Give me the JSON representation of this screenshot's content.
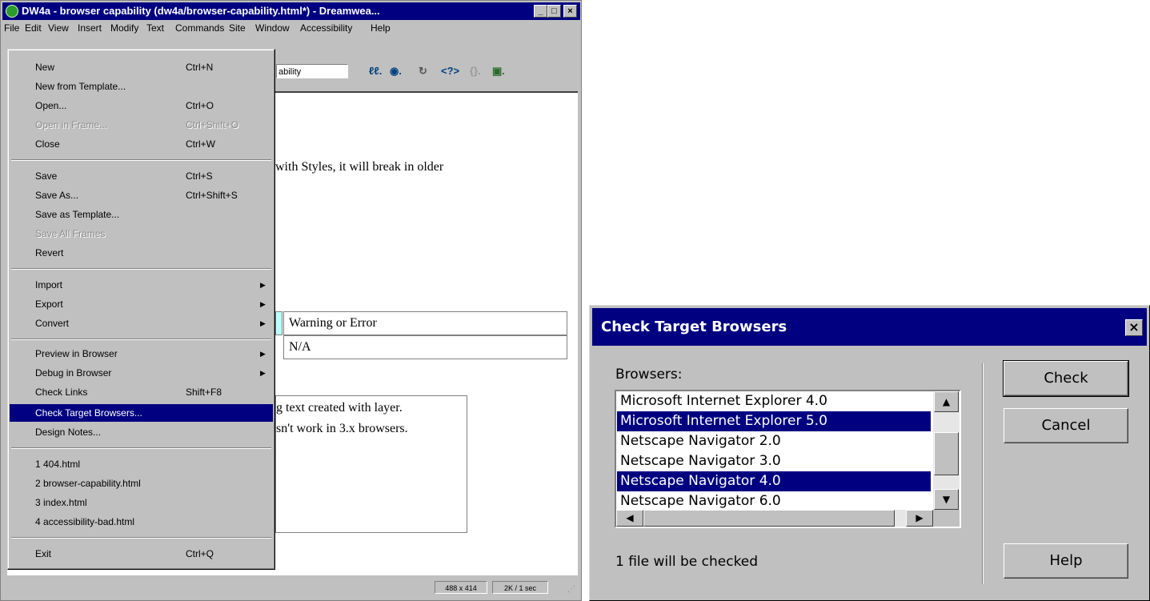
{
  "window": {
    "title": "DW4a - browser capability (dw4a/browser-capability.html*) - Dreamwea...",
    "controls": {
      "minimize": "_",
      "maximize": "□",
      "close": "×"
    }
  },
  "menubar": [
    "File",
    "Edit",
    "View",
    "Insert",
    "Modify",
    "Text",
    "Commands",
    "Site",
    "Window",
    "Accessibility",
    "Help"
  ],
  "toolbar": {
    "title_field": "ability"
  },
  "document": {
    "line1": "with Styles, it will break in older",
    "table": [
      [
        "Warning or Error"
      ],
      [
        "N/A"
      ]
    ],
    "layer_text_1": "g text created with layer.",
    "layer_text_2": "sn't work in 3.x browsers."
  },
  "statusbar": {
    "size": "488 x 414",
    "download": "2K / 1 sec"
  },
  "file_menu": {
    "items": [
      {
        "label": "New",
        "shortcut": "Ctrl+N"
      },
      {
        "label": "New from Template...",
        "shortcut": ""
      },
      {
        "label": "Open...",
        "shortcut": "Ctrl+O"
      },
      {
        "label": "Open in Frame...",
        "shortcut": "Ctrl+Shift+O",
        "disabled": true
      },
      {
        "label": "Close",
        "shortcut": "Ctrl+W"
      },
      {
        "label": "Save",
        "shortcut": "Ctrl+S"
      },
      {
        "label": "Save As...",
        "shortcut": "Ctrl+Shift+S"
      },
      {
        "label": "Save as Template...",
        "shortcut": ""
      },
      {
        "label": "Save All Frames",
        "shortcut": "",
        "disabled": true
      },
      {
        "label": "Revert",
        "shortcut": ""
      },
      {
        "label": "Import",
        "shortcut": "",
        "submenu": true
      },
      {
        "label": "Export",
        "shortcut": "",
        "submenu": true
      },
      {
        "label": "Convert",
        "shortcut": "",
        "submenu": true
      },
      {
        "label": "Preview in Browser",
        "shortcut": "",
        "submenu": true
      },
      {
        "label": "Debug in Browser",
        "shortcut": "",
        "submenu": true
      },
      {
        "label": "Check Links",
        "shortcut": "Shift+F8"
      },
      {
        "label": "Check Target Browsers...",
        "shortcut": "",
        "selected": true
      },
      {
        "label": "Design Notes...",
        "shortcut": ""
      },
      {
        "label": "1 404.html",
        "shortcut": ""
      },
      {
        "label": "2 browser-capability.html",
        "shortcut": ""
      },
      {
        "label": "3 index.html",
        "shortcut": ""
      },
      {
        "label": "4 accessibility-bad.html",
        "shortcut": ""
      },
      {
        "label": "Exit",
        "shortcut": "Ctrl+Q"
      }
    ]
  },
  "dialog": {
    "title": "Check Target Browsers",
    "close": "×",
    "browsers_label": "Browsers:",
    "browsers": [
      {
        "name": "Microsoft Internet Explorer 4.0",
        "selected": false
      },
      {
        "name": "Microsoft Internet Explorer 5.0",
        "selected": true
      },
      {
        "name": "Netscape Navigator 2.0",
        "selected": false
      },
      {
        "name": "Netscape Navigator 3.0",
        "selected": false
      },
      {
        "name": "Netscape Navigator 4.0",
        "selected": true
      },
      {
        "name": "Netscape Navigator 6.0",
        "selected": false
      }
    ],
    "status": "1 file will be checked",
    "buttons": {
      "check": "Check",
      "cancel": "Cancel",
      "help": "Help"
    }
  }
}
